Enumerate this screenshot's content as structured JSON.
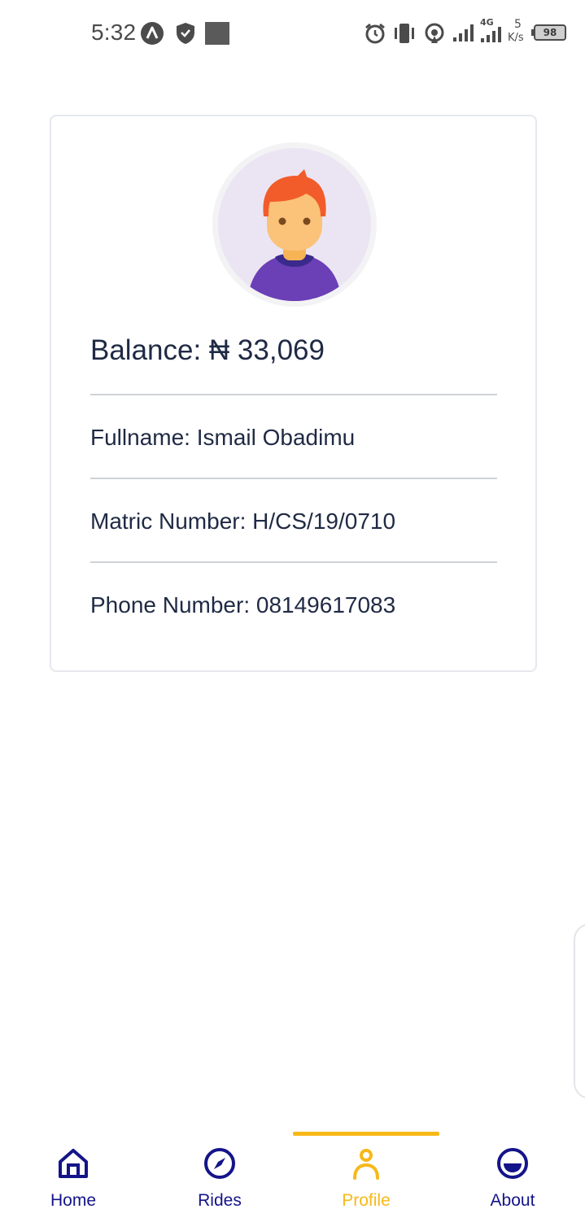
{
  "status_bar": {
    "time": "5:32",
    "network_type": "4G",
    "speed_value": "5",
    "speed_unit": "K/s",
    "battery": "98",
    "icons": [
      "app-a-icon",
      "shield-icon",
      "square-notification-icon",
      "alarm-icon",
      "vibrate-icon",
      "hotspot-icon",
      "signal-icon",
      "signal-4g-icon",
      "battery-icon"
    ]
  },
  "profile": {
    "balance": "Balance: ₦ 33,069",
    "fullname": "Fullname: Ismail Obadimu",
    "matric": "Matric Number: H/CS/19/0710",
    "phone": "Phone Number: 08149617083"
  },
  "nav": {
    "home": "Home",
    "rides": "Rides",
    "profile": "Profile",
    "about": "About",
    "active": "profile"
  },
  "colors": {
    "nav_primary": "#14148a",
    "nav_active": "#f7b818",
    "text": "#1f2a44",
    "avatar_bg": "#ebe5f3"
  }
}
